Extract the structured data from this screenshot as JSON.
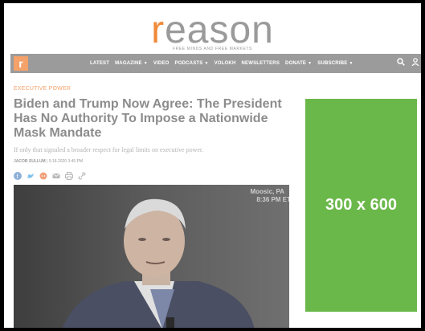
{
  "masthead": {
    "logo": "reason",
    "tagline": "FREE MINDS AND FREE MARKETS"
  },
  "nav": {
    "badge": "r",
    "items": [
      {
        "label": "LATEST",
        "has_caret": false
      },
      {
        "label": "MAGAZINE",
        "has_caret": true
      },
      {
        "label": "VIDEO",
        "has_caret": false
      },
      {
        "label": "PODCASTS",
        "has_caret": true
      },
      {
        "label": "VOLOKH",
        "has_caret": false
      },
      {
        "label": "NEWSLETTERS",
        "has_caret": false
      },
      {
        "label": "DONATE",
        "has_caret": true
      },
      {
        "label": "SUBSCRIBE",
        "has_caret": true
      }
    ],
    "icons": [
      "search-icon",
      "user-icon"
    ]
  },
  "article": {
    "kicker": "EXECUTIVE POWER",
    "headline": "Biden and Trump Now Agree: The President Has No Authority To Impose a Nationwide Mask Mandate",
    "dek": "If only that signaled a broader respect for legal limits on executive power.",
    "author": "JACOB SULLUM",
    "date": "9.18.2020 3:45 PM",
    "share_icons": [
      "facebook-icon",
      "twitter-icon",
      "reddit-icon",
      "email-icon",
      "print-icon",
      "link-icon"
    ],
    "share_colors": {
      "facebook": "#8fb0d8",
      "twitter": "#7fc2ea",
      "reddit": "#f3a07a",
      "email": "#b8b8b8",
      "print": "#b8b8b8",
      "link": "#b8b8b8"
    }
  },
  "hero": {
    "location": "Moosic, PA",
    "time": "8:36 PM ET"
  },
  "ad": {
    "label": "300 x 600",
    "color": "#6bb84a"
  },
  "colors": {
    "accent": "#f4a16a",
    "nav_bg": "#9b9b9b"
  }
}
